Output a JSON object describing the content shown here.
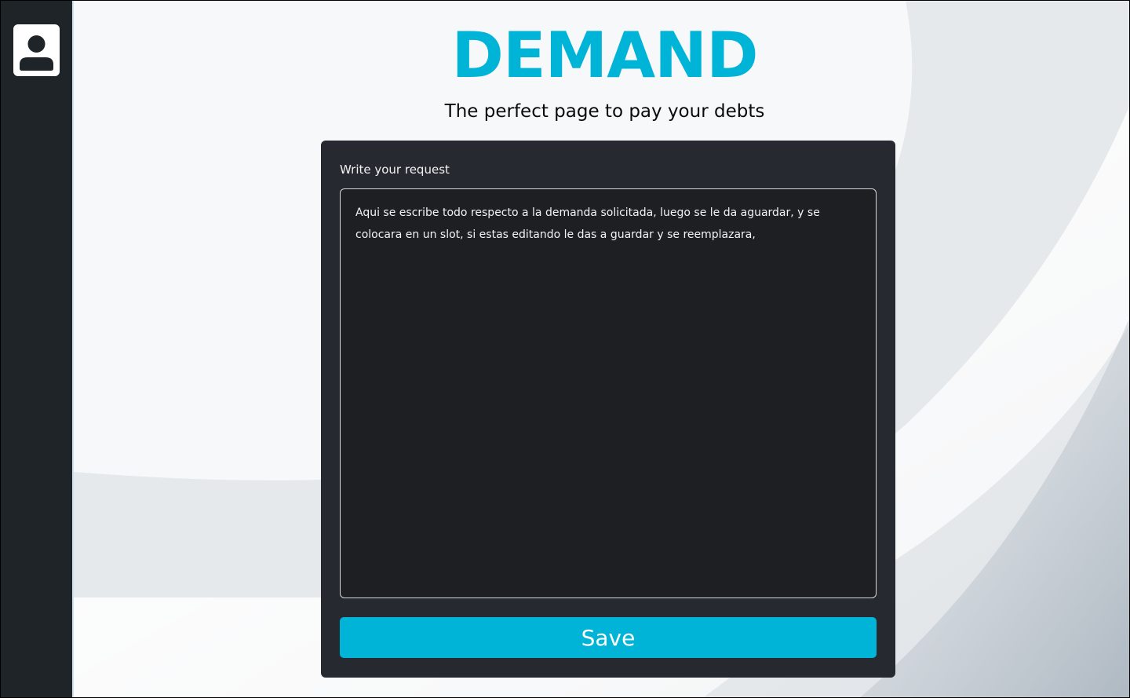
{
  "header": {
    "title": "DEMAND",
    "subtitle": "The perfect page to pay your debts"
  },
  "sidebar": {
    "avatar_icon": "user-avatar-icon"
  },
  "form": {
    "label": "Write your request",
    "textarea_value": "Aqui se escribe todo respecto a la demanda solicitada, luego se le da aguardar, y se colocara en un slot, si estas editando le das a guardar y se reemplazara,",
    "save_label": "Save"
  },
  "colors": {
    "accent": "#00b4d8",
    "sidebar": "#1e2428",
    "card": "#262a30",
    "textarea": "#1e1f23"
  }
}
